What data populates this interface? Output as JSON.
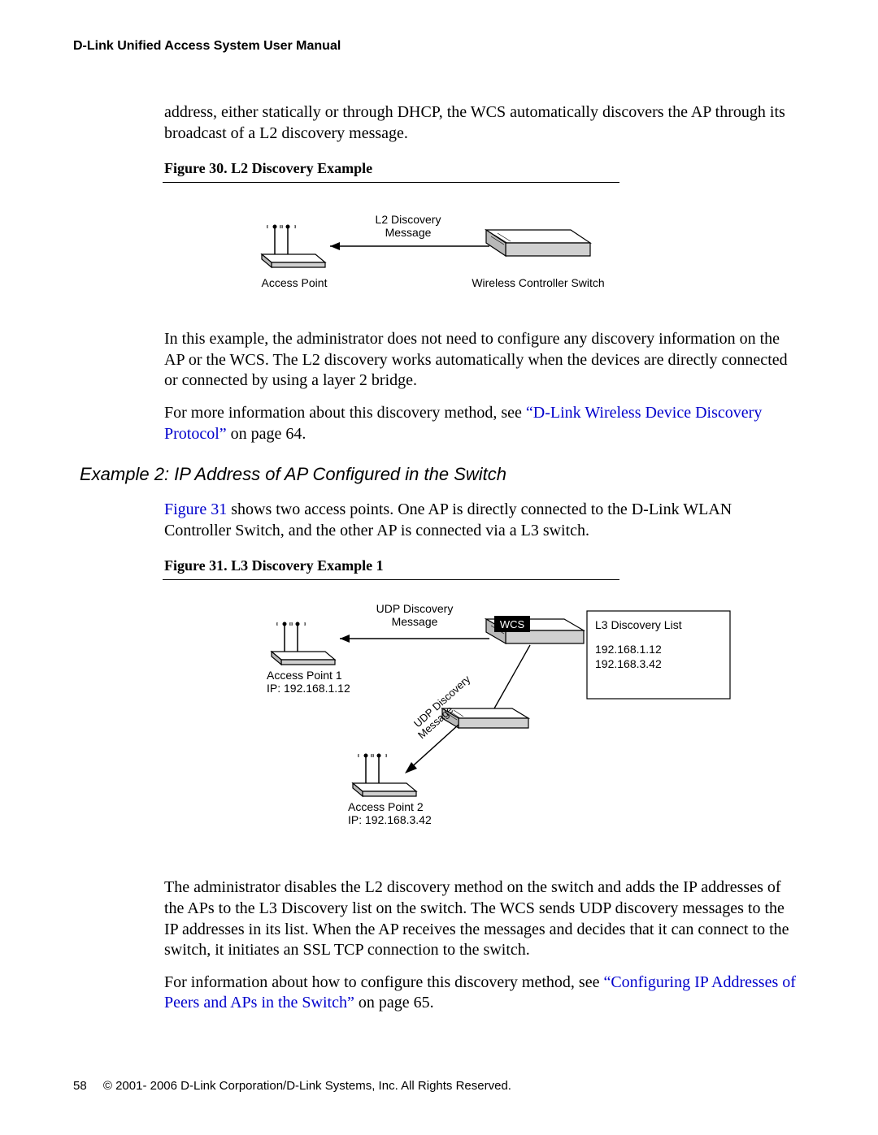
{
  "header": "D-Link Unified Access System User Manual",
  "para1": "address, either statically or through DHCP, the WCS automatically discovers the AP through its broadcast of a L2 discovery message.",
  "fig30": {
    "caption": "Figure 30.  L2 Discovery Example",
    "msg_l1": "L2 Discovery",
    "msg_l2": "Message",
    "ap_label": "Access Point",
    "wcs_label": "Wireless Controller Switch"
  },
  "para2": "In this example, the administrator does not need to configure any discovery information on the AP or the WCS. The L2 discovery works automatically when the devices are directly connected or connected by using a layer 2 bridge.",
  "para3_pre": "For more information about this discovery method, see ",
  "para3_link": "“D-Link Wireless Device Discovery Protocol”",
  "para3_post": " on page 64.",
  "example2_heading": "Example 2: IP Address of AP Configured in the Switch",
  "para4_link": "Figure 31",
  "para4_post": " shows two access points. One AP is directly connected to the D-Link WLAN Controller Switch, and the other AP is connected via a L3 switch.",
  "fig31": {
    "caption": "Figure 31.  L3 Discovery Example 1",
    "udp_l1": "UDP Discovery",
    "udp_l2": "Message",
    "wcs": "WCS",
    "list_title": "L3 Discovery List",
    "list_ip1": "192.168.1.12",
    "list_ip2": "192.168.3.42",
    "ap1_l1": "Access Point 1",
    "ap1_l2": "IP: 192.168.1.12",
    "ap2_l1": "Access Point 2",
    "ap2_l2": "IP: 192.168.3.42",
    "diag_msg": "UDP Discovery Message"
  },
  "para5": "The administrator disables the L2 discovery method on the switch and adds the IP addresses of the APs to the L3 Discovery list on the switch. The WCS sends UDP discovery messages to the IP addresses in its list. When the AP receives the messages and decides that it can connect to the switch, it initiates an SSL TCP connection to the switch.",
  "para6_pre": "For information about how to configure this discovery method, see ",
  "para6_link": "“Configuring IP Addresses of Peers and APs in the Switch”",
  "para6_post": " on page 65.",
  "footer": {
    "page": "58",
    "copyright": "© 2001- 2006 D-Link Corporation/D-Link Systems, Inc. All Rights Reserved."
  }
}
